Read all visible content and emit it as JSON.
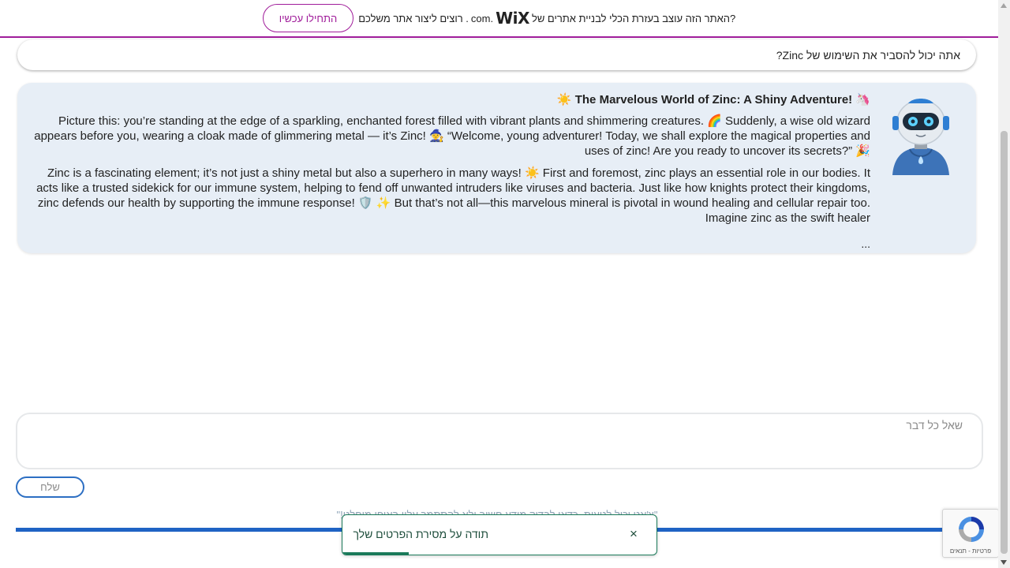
{
  "banner": {
    "promo_before": "רוצים ליצור אתר משלכם?",
    "promo_before_visible": ". רוצים ליצור אתר משלכם",
    "promo_after": "?האתר הזה עוצב בעזרת הכלי לבניית אתרים של",
    "brand": "WiX",
    "brand_suffix": ".com",
    "cta": "התחילו עכשיו",
    "accent": "#a01d9a"
  },
  "question": {
    "text": "אתה יכול להסביר את השימוש של Zinc?"
  },
  "answer": {
    "avatar_icon": "robot-avatar-icon",
    "title": "☀️ The Marvelous World of Zinc: A Shiny Adventure! 🦄",
    "paragraph1": "Picture this: you’re standing at the edge of a sparkling, enchanted forest filled with vibrant plants and shimmering creatures. 🌈 Suddenly, a wise old wizard appears before you, wearing a cloak made of glimmering metal — it’s Zinc! 🧙 “Welcome, young adventurer! Today, we shall explore the magical properties and uses of zinc! Are you ready to uncover its secrets?” 🎉",
    "paragraph2": "Zinc is a fascinating element; it’s not just a shiny metal but also a superhero in many ways! ☀️ First and foremost, zinc plays an essential role in our bodies. It acts like a trusted sidekick for our immune system, helping to fend off unwanted intruders like viruses and bacteria. Just like how knights protect their kingdoms, zinc defends our health by supporting the immune response! 🛡️ ✨ But that’s not all—this marvelous mineral is pivotal in wound healing and cellular repair too. Imagine zinc as the swift healer",
    "ellipsis": "..."
  },
  "composer": {
    "placeholder": "שאל כל דבר",
    "send_label": "שלח",
    "accent": "#1f63c4"
  },
  "disclaimer": {
    "text": "\"צ'אט יכול לטעות. כדאי לבדוק מידע חשוב ולא להסתמך עליו באופן מוחלט!\""
  },
  "toast": {
    "message": "תודה על מסירת הפרטים שלך",
    "close_icon": "close-icon",
    "progress": 0.21,
    "accent": "#1b7a5a"
  },
  "recaptcha": {
    "icon": "recaptcha-icon",
    "label": "פרטיות - תנאים"
  }
}
